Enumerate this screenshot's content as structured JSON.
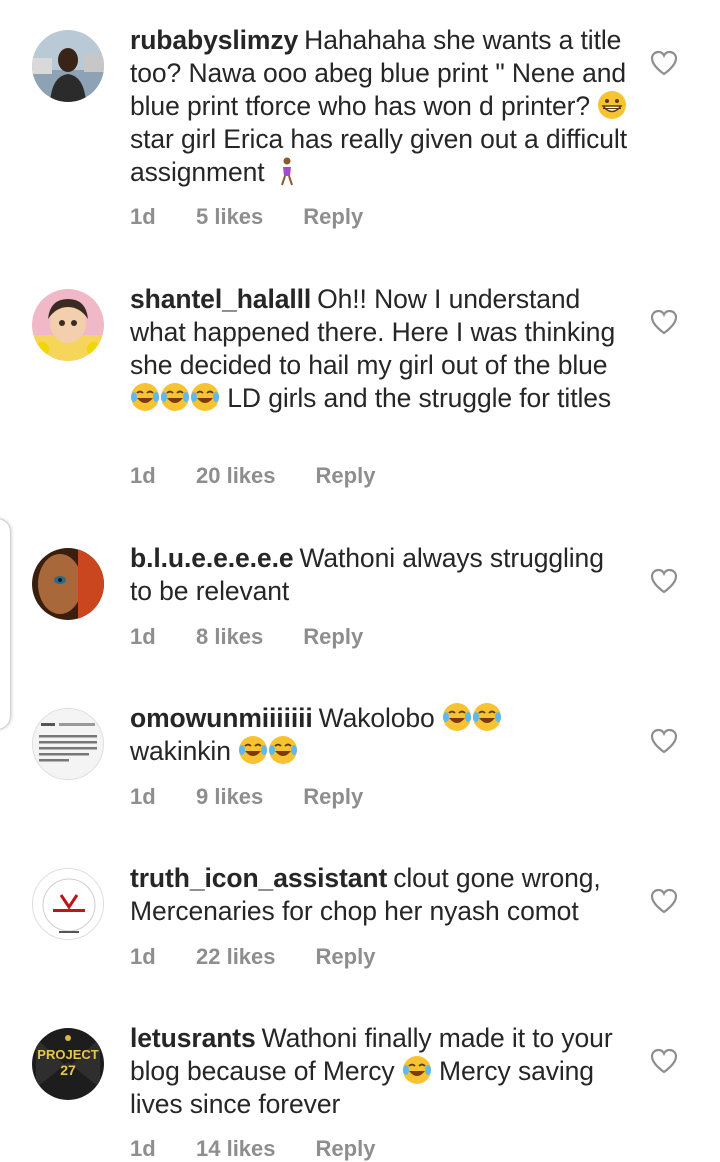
{
  "comments": [
    {
      "username": "rubabyslimzy",
      "text_parts": [
        "Hahahaha she wants a title too? Nawa ooo abeg blue print \" Nene and blue print tforce who has won d printer? ",
        " star girl Erica has really given out a difficult assignment "
      ],
      "time": "1d",
      "likes": "5 likes",
      "reply": "Reply"
    },
    {
      "username": "shantel_halalll",
      "text_parts": [
        "Oh!! Now I understand what happened there. Here I was thinking she decided to hail my girl out of the blue",
        " LD girls and the struggle for titles"
      ],
      "time": "1d",
      "likes": "20 likes",
      "reply": "Reply"
    },
    {
      "username": "b.l.u.e.e.e.e.e",
      "text_parts": [
        "Wathoni always struggling to be relevant"
      ],
      "time": "1d",
      "likes": "8 likes",
      "reply": "Reply"
    },
    {
      "username": "omowunmiiiiiii",
      "text_parts": [
        "Wakolobo ",
        " wakinkin "
      ],
      "time": "1d",
      "likes": "9 likes",
      "reply": "Reply"
    },
    {
      "username": "truth_icon_assistant",
      "text_parts": [
        "clout gone wrong, Mercenaries for chop her nyash comot"
      ],
      "time": "1d",
      "likes": "22 likes",
      "reply": "Reply"
    },
    {
      "username": "letusrants",
      "text_parts": [
        "Wathoni finally made it to your blog because of Mercy ",
        " Mercy saving lives since forever"
      ],
      "time": "1d",
      "likes": "14 likes",
      "reply": "Reply"
    }
  ],
  "avatar_texts": {
    "project27_line1": "PROJECT",
    "project27_line2": "27"
  },
  "colors": {
    "text": "#262626",
    "meta": "#8e8e8e",
    "heart": "#8e8e8e"
  }
}
